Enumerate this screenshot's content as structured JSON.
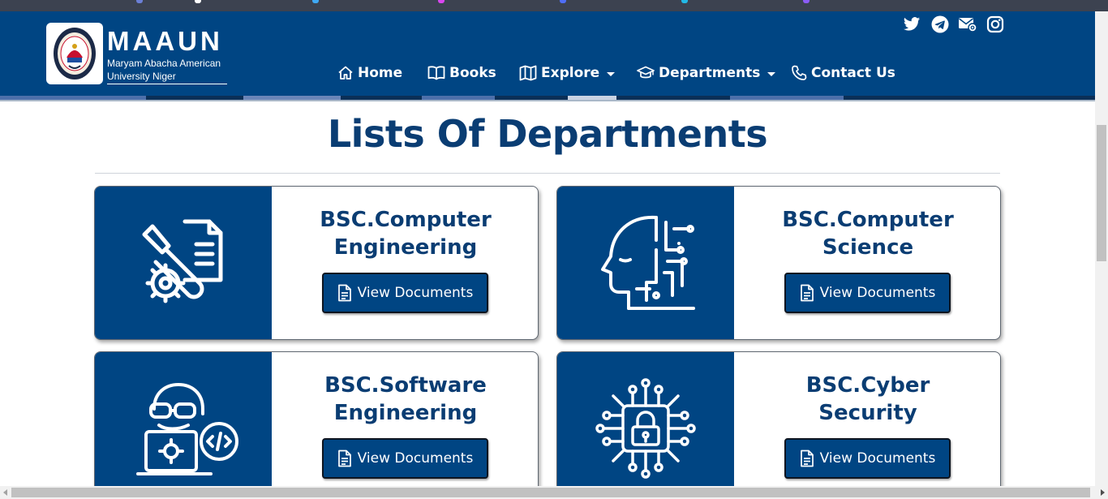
{
  "brand": {
    "name": "MAAUN",
    "subtitle_line1": "Maryam Abacha American",
    "subtitle_line2": "University Niger"
  },
  "social": [
    "twitter-icon",
    "telegram-icon",
    "email-icon",
    "instagram-icon"
  ],
  "nav": {
    "home": "Home",
    "books": "Books",
    "explore": "Explore",
    "departments": "Departments",
    "contact": "Contact Us"
  },
  "heading": "Lists Of Departments",
  "departments": [
    {
      "title_line1": "BSC.Computer",
      "title_line2": "Engineering",
      "button": "View Documents",
      "icon": "engineering-tools-icon"
    },
    {
      "title_line1": "BSC.Computer",
      "title_line2": "Science",
      "button": "View Documents",
      "icon": "ai-head-icon"
    },
    {
      "title_line1": "BSC.Software",
      "title_line2": "Engineering",
      "button": "View Documents",
      "icon": "developer-icon"
    },
    {
      "title_line1": "BSC.Cyber",
      "title_line2": "Security",
      "button": "View Documents",
      "icon": "security-chip-icon"
    }
  ],
  "colors": {
    "brand_blue": "#004583",
    "heading_blue": "#0a3d73",
    "white": "#ffffff"
  }
}
